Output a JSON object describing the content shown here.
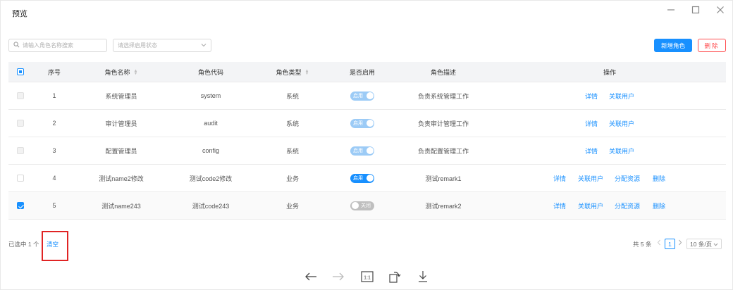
{
  "window": {
    "title": "预览"
  },
  "filters": {
    "search_placeholder": "请输入角色名称搜索",
    "status_placeholder": "请选择启用状态"
  },
  "actions": {
    "add_label": "新增角色",
    "delete_label": "删除"
  },
  "table": {
    "columns": {
      "index": "序号",
      "name": "角色名称",
      "code": "角色代码",
      "type": "角色类型",
      "enabled": "是否启用",
      "desc": "角色描述",
      "ops": "操作"
    },
    "rows": [
      {
        "index": "1",
        "name": "系统管理员",
        "code": "system",
        "type": "系统",
        "switch_text": "启用",
        "desc": "负责系统管理工作",
        "op_detail": "详情",
        "op_link_user": "关联用户"
      },
      {
        "index": "2",
        "name": "审计管理员",
        "code": "audit",
        "type": "系统",
        "switch_text": "启用",
        "desc": "负责审计管理工作",
        "op_detail": "详情",
        "op_link_user": "关联用户"
      },
      {
        "index": "3",
        "name": "配置管理员",
        "code": "config",
        "type": "系统",
        "switch_text": "启用",
        "desc": "负责配置管理工作",
        "op_detail": "详情",
        "op_link_user": "关联用户"
      },
      {
        "index": "4",
        "name": "测试name2修改",
        "code": "测试code2修改",
        "type": "业务",
        "switch_text": "启用",
        "desc": "测试remark1",
        "op_detail": "详情",
        "op_link_user": "关联用户",
        "op_assign": "分配资源",
        "op_delete": "删除"
      },
      {
        "index": "5",
        "name": "测试name243",
        "code": "测试code243",
        "type": "业务",
        "switch_text": "关闭",
        "desc": "测试remark2",
        "op_detail": "详情",
        "op_link_user": "关联用户",
        "op_assign": "分配资源",
        "op_delete": "删除"
      }
    ]
  },
  "footer": {
    "selected_text": "已选中 1 个",
    "clear_label": "清空",
    "total_text": "共 5 条",
    "current_page": "1",
    "page_size": "10 条/页"
  },
  "colors": {
    "primary": "#1890ff",
    "danger": "#ff4d4f",
    "highlight": "#e02424"
  }
}
